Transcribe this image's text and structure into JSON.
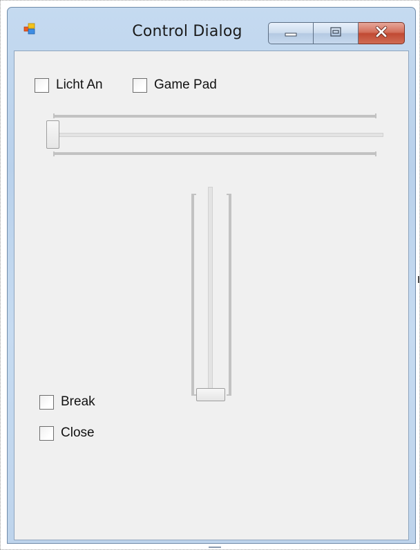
{
  "window": {
    "title": "Control Dialog",
    "icon": "app-window-icon",
    "caption_buttons": [
      {
        "name": "minimize",
        "icon": "minimize-icon"
      },
      {
        "name": "maximize",
        "icon": "maximize-icon"
      },
      {
        "name": "close",
        "icon": "close-icon"
      }
    ]
  },
  "checkboxes": {
    "licht_an": {
      "label": "Licht An",
      "checked": false
    },
    "game_pad": {
      "label": "Game Pad",
      "checked": false
    },
    "break": {
      "label": "Break",
      "checked": false
    },
    "close": {
      "label": "Close",
      "checked": false
    }
  },
  "trackbars": {
    "horizontal": {
      "value_fraction": 0.0
    },
    "vertical": {
      "value_fraction": 0.0
    }
  },
  "colors": {
    "client_background": "#f0f0f0",
    "close_button": "#c8553d",
    "frame": "#c5daf0"
  }
}
